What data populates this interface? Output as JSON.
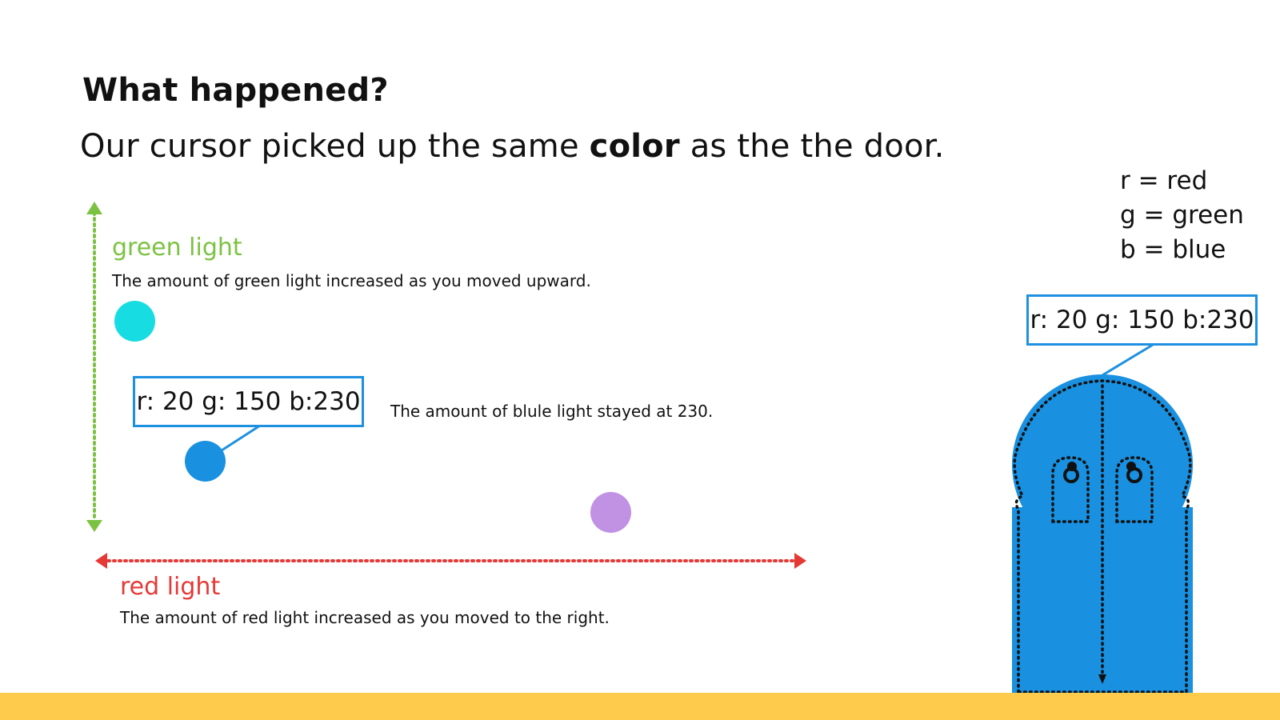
{
  "heading": "What happened?",
  "subheading": {
    "before": "Our cursor picked up the same ",
    "bold": "color",
    "after": " as the the door."
  },
  "legend": [
    "r = red",
    "g = green",
    "b = blue"
  ],
  "green_axis": {
    "title": "green light",
    "description": "The amount of green light increased as you moved upward.",
    "color": "#7cc242"
  },
  "red_axis": {
    "title": "red light",
    "description": "The amount of red light increased as you moved to the right.",
    "color": "#e53935"
  },
  "blue_note": "The amount of blule light stayed at 230.",
  "cursor_readout": "r: 20 g: 150 b:230",
  "door_readout": "r: 20 g: 150 b:230",
  "colors": {
    "cyan_dot": "#17dde3",
    "blue_dot": "#1990e0",
    "purple_dot": "#c191e4",
    "door": "#1990e0",
    "readout_border": "#1e90e0",
    "footer": "#ffcb4d"
  }
}
